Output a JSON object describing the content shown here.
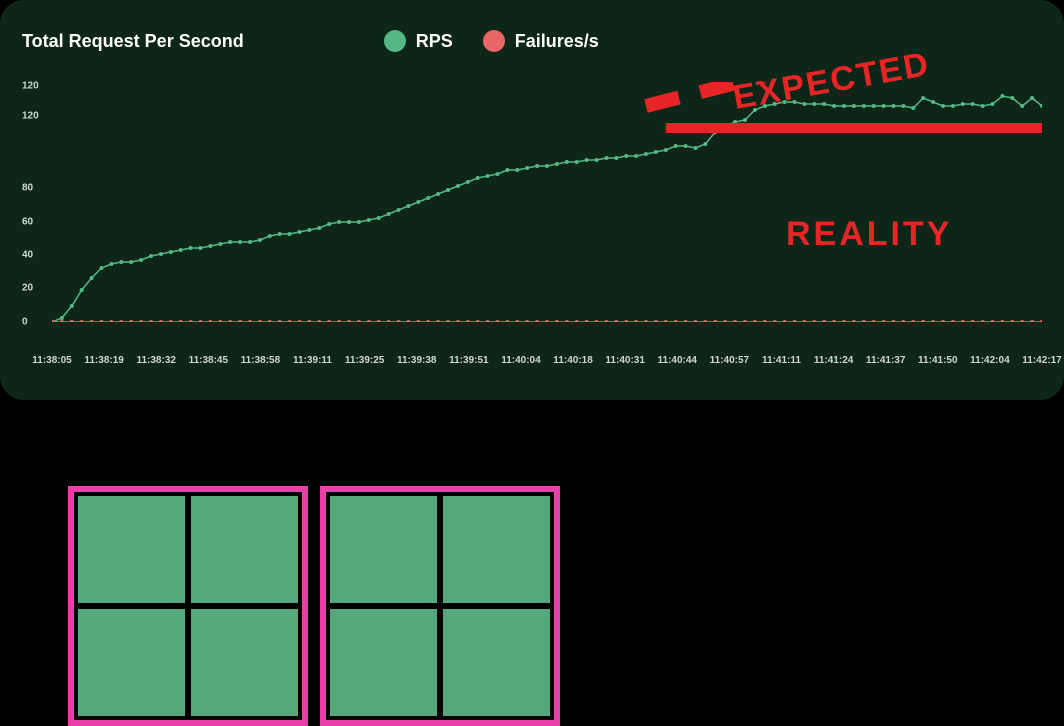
{
  "panel": {
    "title": "Total Request Per Second",
    "legend": {
      "rps": "RPS",
      "failures": "Failures/s"
    },
    "colors": {
      "rps": "#55b786",
      "failures": "#ea6666",
      "annotation": "#e62626"
    },
    "annotations": {
      "expected": "EXPECTED",
      "reality": "REALITY"
    }
  },
  "chart_data": {
    "type": "line",
    "title": "Total Request Per Second",
    "xlabel": "",
    "ylabel": "",
    "ylim": [
      0,
      120
    ],
    "y_ticks": [
      0,
      20,
      40,
      60,
      80,
      120,
      120
    ],
    "x_ticks": [
      "11:38:05",
      "11:38:19",
      "11:38:32",
      "11:38:45",
      "11:38:58",
      "11:39:11",
      "11:39:25",
      "11:39:38",
      "11:39:51",
      "11:40:04",
      "11:40:18",
      "11:40:31",
      "11:40:44",
      "11:40:57",
      "11:41:11",
      "11:41:24",
      "11:41:37",
      "11:41:50",
      "11:42:04",
      "11:42:17"
    ],
    "series": [
      {
        "name": "RPS",
        "color": "#55b786",
        "values": [
          0,
          2,
          8,
          16,
          22,
          27,
          29,
          30,
          30,
          31,
          33,
          34,
          35,
          36,
          37,
          37,
          38,
          39,
          40,
          40,
          40,
          41,
          43,
          44,
          44,
          45,
          46,
          47,
          49,
          50,
          50,
          50,
          51,
          52,
          54,
          56,
          58,
          60,
          62,
          64,
          66,
          68,
          70,
          72,
          73,
          74,
          76,
          76,
          77,
          78,
          78,
          79,
          80,
          80,
          81,
          81,
          82,
          82,
          83,
          83,
          84,
          85,
          86,
          88,
          88,
          87,
          89,
          95,
          98,
          100,
          101,
          106,
          108,
          109,
          110,
          110,
          109,
          109,
          109,
          108,
          108,
          108,
          108,
          108,
          108,
          108,
          108,
          107,
          112,
          110,
          108,
          108,
          109,
          109,
          108,
          109,
          113,
          112,
          108,
          112,
          108
        ]
      },
      {
        "name": "Failures/s",
        "color": "#ea6666",
        "values": [
          0,
          0,
          0,
          0,
          0,
          0,
          0,
          0,
          0,
          0,
          0,
          0,
          0,
          0,
          0,
          0,
          0,
          0,
          0,
          0,
          0,
          0,
          0,
          0,
          0,
          0,
          0,
          0,
          0,
          0,
          0,
          0,
          0,
          0,
          0,
          0,
          0,
          0,
          0,
          0,
          0,
          0,
          0,
          0,
          0,
          0,
          0,
          0,
          0,
          0,
          0,
          0,
          0,
          0,
          0,
          0,
          0,
          0,
          0,
          0,
          0,
          0,
          0,
          0,
          0,
          0,
          0,
          0,
          0,
          0,
          0,
          0,
          0,
          0,
          0,
          0,
          0,
          0,
          0,
          0,
          0,
          0,
          0,
          0,
          0,
          0,
          0,
          0,
          0,
          0,
          0,
          0,
          0,
          0,
          0,
          0,
          0,
          0,
          0,
          0,
          0
        ]
      }
    ],
    "annotations": [
      {
        "label": "EXPECTED",
        "style": "dashed-rising",
        "x_from": 0.62,
        "x_to": 1.0
      },
      {
        "label": "REALITY",
        "style": "solid-flat",
        "x_from": 0.62,
        "x_to": 1.0,
        "y": 100
      }
    ]
  }
}
